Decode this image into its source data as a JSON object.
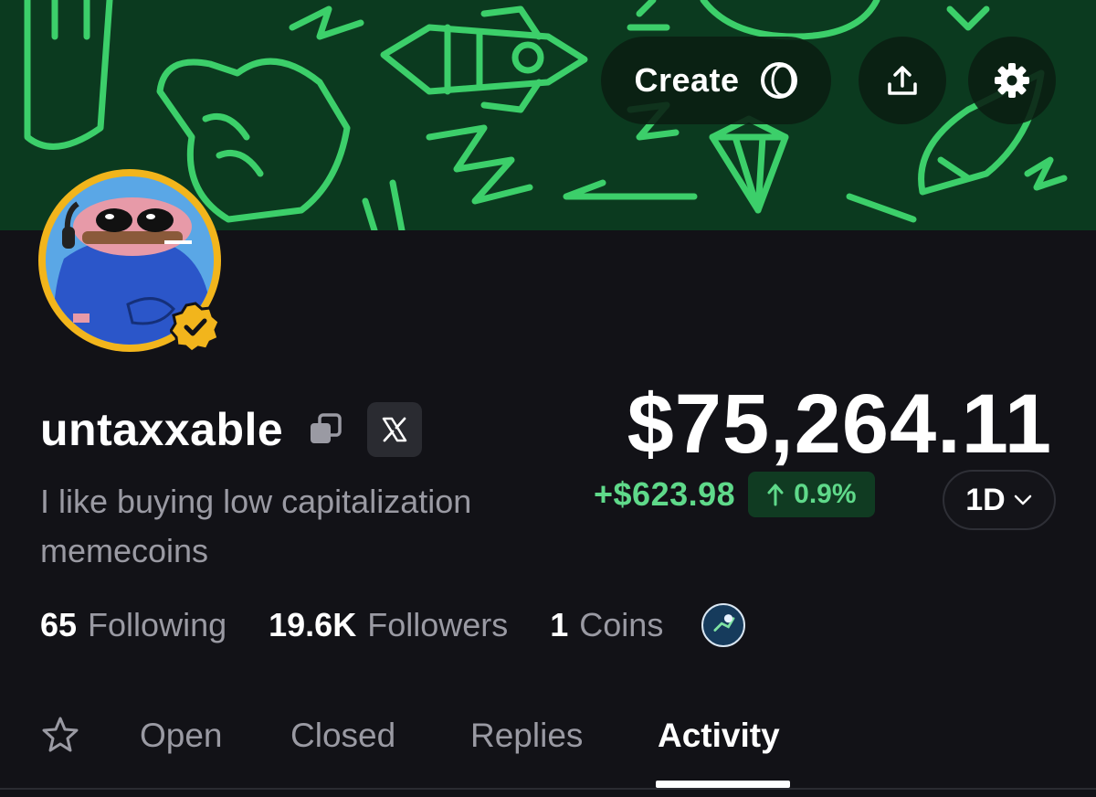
{
  "header": {
    "create_label": "Create"
  },
  "profile": {
    "username": "untaxxable",
    "bio": "I like buying low capitalization memecoins",
    "balance": "$75,264.11",
    "pnl_value": "+$623.98",
    "pnl_percent": "0.9%",
    "timeframe": "1D",
    "stats": {
      "following_count": "65",
      "following_label": "Following",
      "followers_count": "19.6K",
      "followers_label": "Followers",
      "coins_count": "1",
      "coins_label": "Coins"
    }
  },
  "tabs": [
    {
      "label": "Open"
    },
    {
      "label": "Closed"
    },
    {
      "label": "Replies"
    },
    {
      "label": "Activity"
    }
  ],
  "colors": {
    "banner_bg": "#0b3a1f",
    "banner_pattern": "#3ccf6a",
    "accent_gold": "#f2b51c",
    "positive": "#5fd98a",
    "bg": "#121217"
  },
  "icons": [
    "rocket-icon",
    "lightning-icon",
    "thumbs-up-icon",
    "gem-icon",
    "share-icon",
    "gear-icon",
    "copy-icon",
    "x-logo-icon",
    "verified-badge-icon",
    "chevron-down-icon",
    "star-icon",
    "arrow-up-icon"
  ]
}
